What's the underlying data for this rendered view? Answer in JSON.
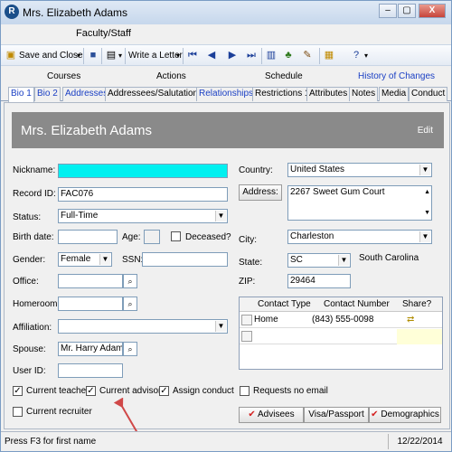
{
  "window": {
    "title": "Mrs. Elizabeth Adams",
    "minimize": "–",
    "maximize": "▢",
    "close": "X"
  },
  "menu": {
    "label": "Faculty/Staff"
  },
  "toolbar": {
    "save_close": "Save and Close",
    "write_letter": "Write a Letter"
  },
  "tabs_top": [
    "Courses",
    "Actions",
    "Schedule",
    "History of Changes"
  ],
  "tabs_bottom": [
    "Bio 1",
    "Bio 2",
    "Addresses",
    "Addressees/Salutations",
    "Relationships",
    "Restrictions 1",
    "Attributes",
    "Notes",
    "Media",
    "Conduct"
  ],
  "header": {
    "name": "Mrs. Elizabeth Adams",
    "edit": "Edit"
  },
  "form": {
    "nickname_label": "Nickname:",
    "nickname_value": "",
    "record_id_label": "Record ID:",
    "record_id_value": "FAC076",
    "status_label": "Status:",
    "status_value": "Full-Time",
    "birth_date_label": "Birth date:",
    "birth_date_value": "",
    "age_label": "Age:",
    "age_value": "",
    "deceased_label": "Deceased?",
    "gender_label": "Gender:",
    "gender_value": "Female",
    "ssn_label": "SSN:",
    "ssn_value": "",
    "office_label": "Office:",
    "office_value": "",
    "homeroom_label": "Homeroom:",
    "homeroom_value": "",
    "affiliation_label": "Affiliation:",
    "affiliation_value": "",
    "spouse_label": "Spouse:",
    "spouse_value": "Mr. Harry Adams",
    "user_id_label": "User ID:",
    "user_id_value": "",
    "country_label": "Country:",
    "country_value": "United States",
    "address_button": "Address:",
    "address_value": "2267 Sweet Gum Court",
    "city_label": "City:",
    "city_value": "Charleston",
    "state_label": "State:",
    "state_value": "SC",
    "state_name": "South Carolina",
    "zip_label": "ZIP:",
    "zip_value": "29464"
  },
  "contacts": {
    "headers": [
      "Contact Type",
      "Contact Number",
      "Share?"
    ],
    "rows": [
      {
        "type": "Home",
        "number": "(843) 555-0098"
      }
    ]
  },
  "checkboxes": {
    "current_teacher": "Current teacher",
    "current_advisor": "Current advisor",
    "assign_conduct": "Assign conduct",
    "current_recruiter": "Current recruiter",
    "requests_no_email": "Requests no email"
  },
  "bottom_buttons": {
    "advisees": "Advisees",
    "visa_passport": "Visa/Passport",
    "demographics": "Demographics"
  },
  "status": {
    "hint": "Press F3 for first name",
    "date": "12/22/2014"
  }
}
